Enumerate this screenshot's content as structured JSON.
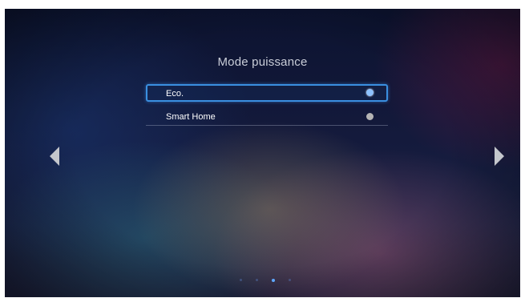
{
  "menu": {
    "title": "Mode puissance",
    "options": [
      {
        "label": "Eco.",
        "selected": true,
        "radio_color": "#8ec2ff"
      },
      {
        "label": "Smart Home",
        "selected": false,
        "radio_color": "#b4b4b4"
      }
    ]
  },
  "navigation": {
    "left_icon": "triangle-left-icon",
    "right_icon": "triangle-right-icon"
  },
  "pagination": {
    "total_pages": 4,
    "current_page": 3
  },
  "colors": {
    "focus_border": "#3a8fe0",
    "active_dot": "#5fa8ff",
    "title_text": "#c9cdd8"
  }
}
